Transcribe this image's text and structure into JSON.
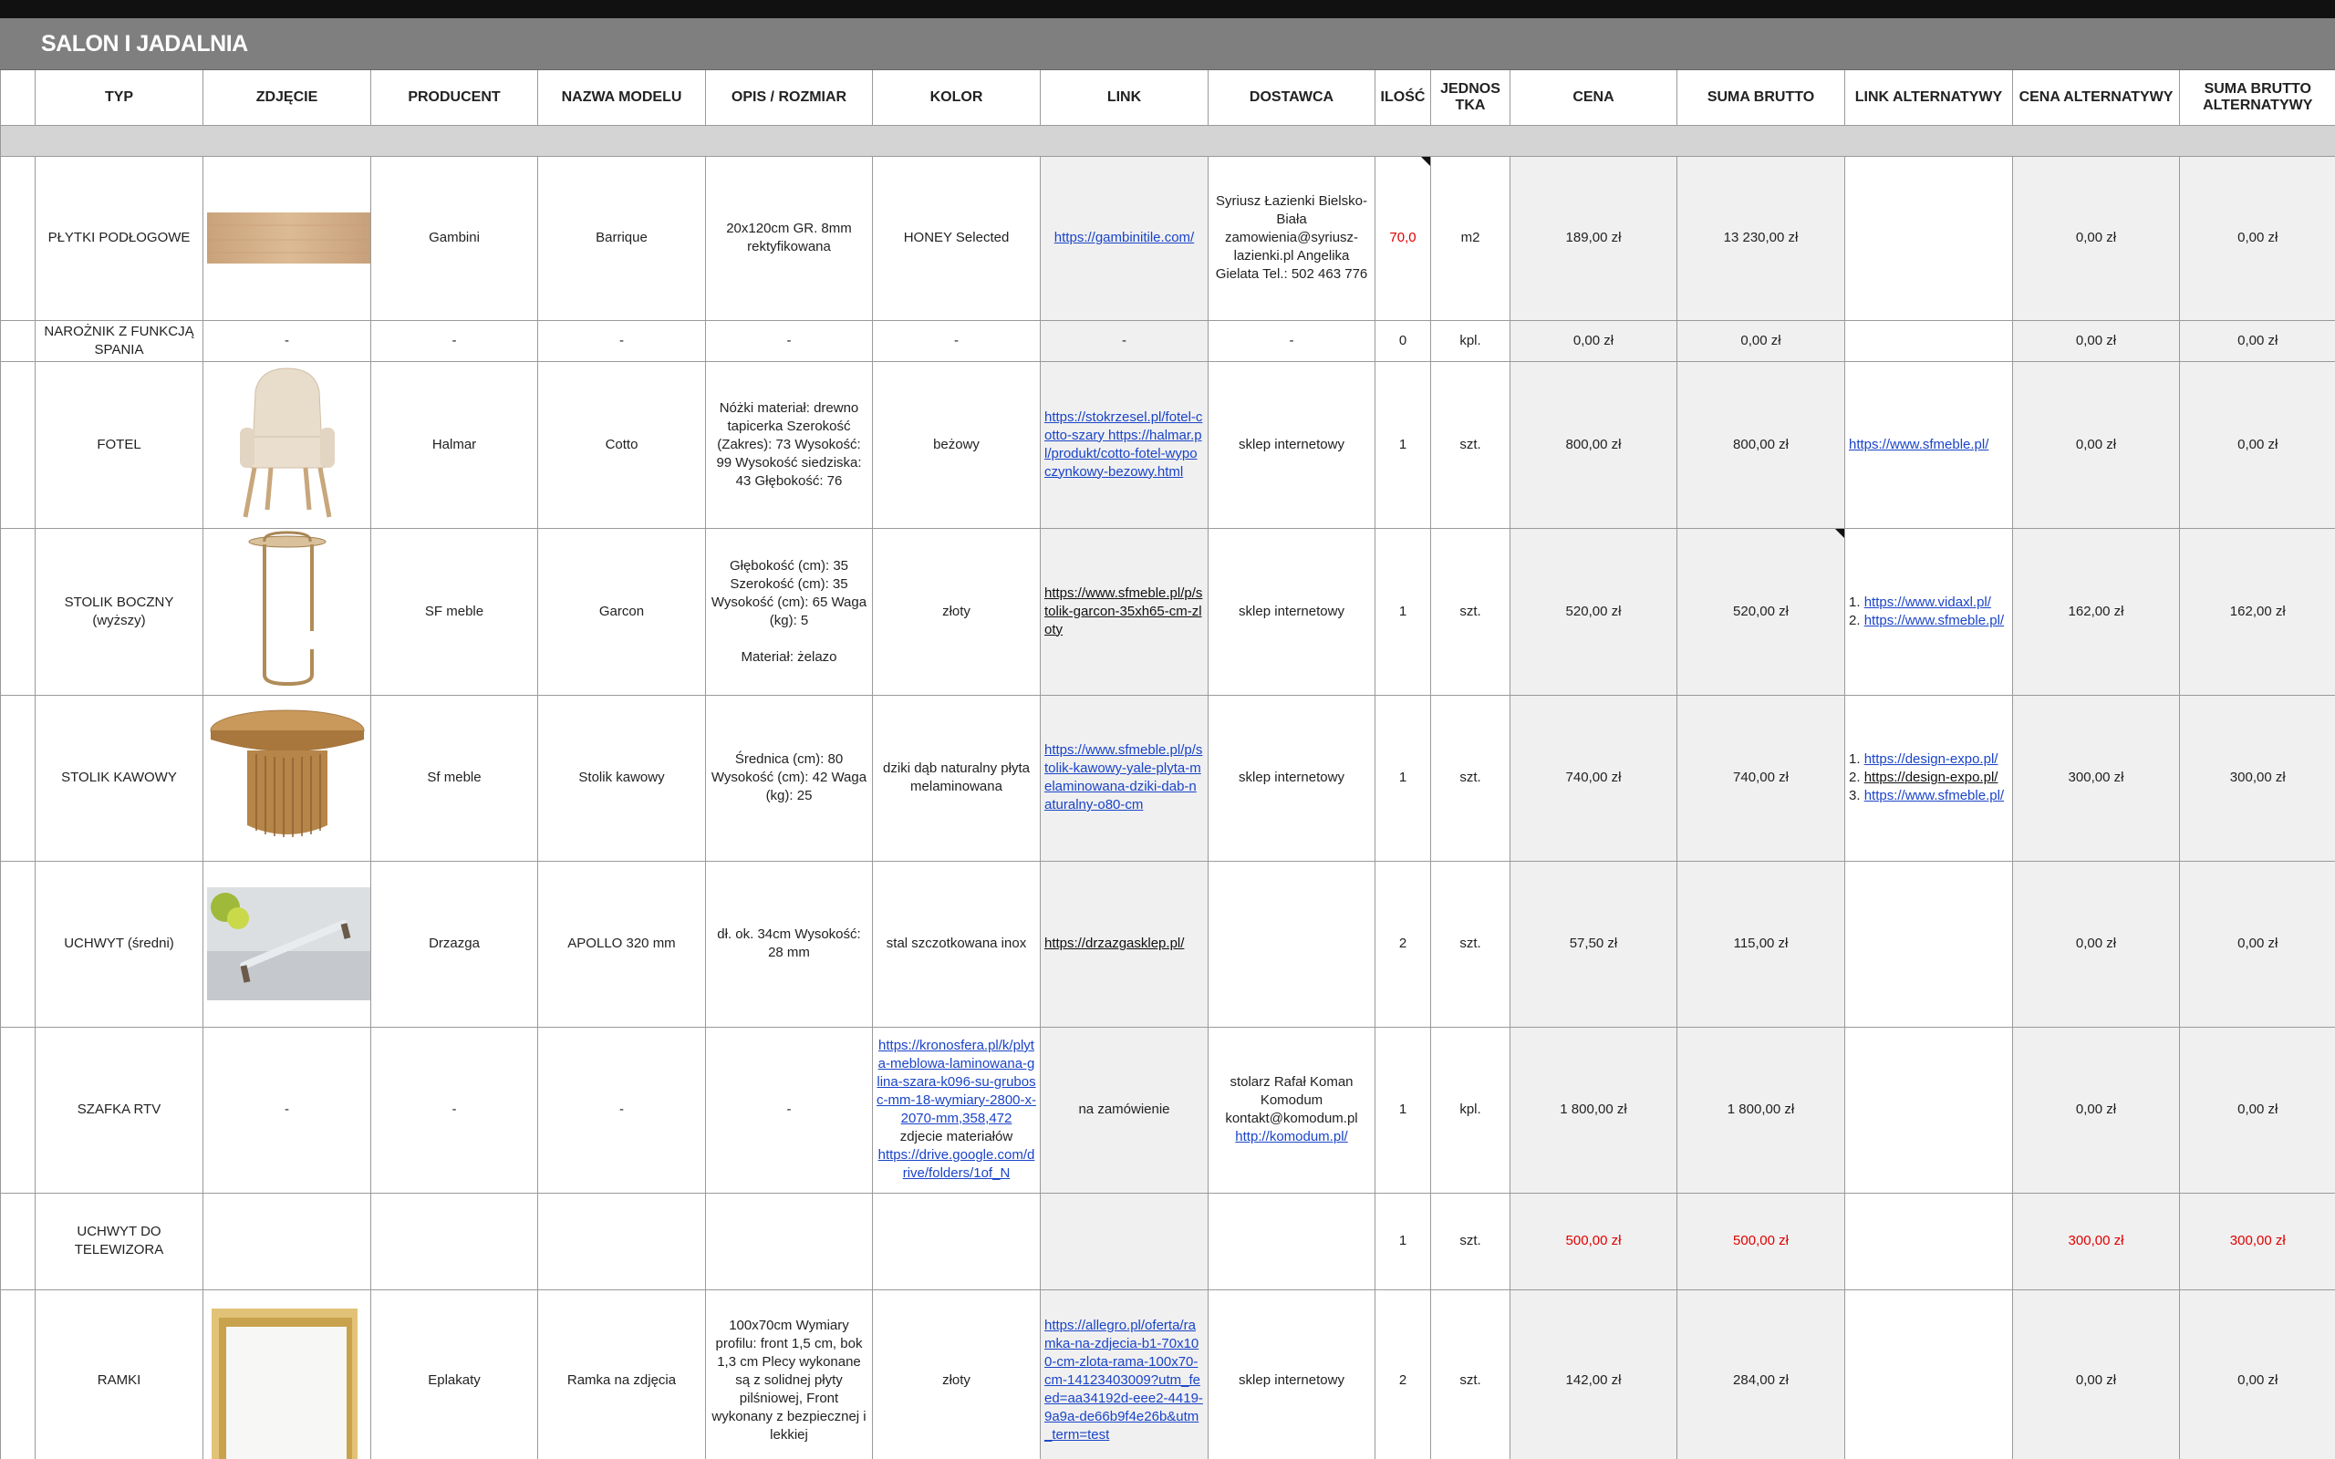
{
  "sheet_title": "SALON I JADALNIA",
  "headers": {
    "typ": "TYP",
    "zdjecie": "ZDJĘCIE",
    "producent": "PRODUCENT",
    "nazwa": "NAZWA MODELU",
    "opis": "OPIS / ROZMIAR",
    "kolor": "KOLOR",
    "link": "LINK",
    "dostawca": "DOSTAWCA",
    "ilosc": "ILOŚĆ",
    "jednostka": "JEDNOS TKA",
    "cena": "CENA",
    "suma": "SUMA BRUTTO",
    "link_alt": "LINK ALTERNATYWY",
    "cena_alt": "CENA ALTERNATYWY",
    "suma_alt": "SUMA BRUTTO ALTERNATYWY"
  },
  "rows": {
    "plytki": {
      "typ": "PŁYTKI PODŁOGOWE",
      "producent": "Gambini",
      "nazwa": "Barrique",
      "opis": "20x120cm GR. 8mm rektyfikowana",
      "kolor": "HONEY Selected",
      "link": "https://gambinitile.com/",
      "dostawca": "Syriusz Łazienki Bielsko-Biała zamowienia@syriusz-lazienki.pl Angelika Gielata Tel.: 502 463 776",
      "ilosc": "70,0",
      "jednostka": "m2",
      "cena": "189,00 zł",
      "suma": "13 230,00 zł",
      "link_alt": "",
      "cena_alt": "0,00 zł",
      "suma_alt": "0,00 zł"
    },
    "naroznik": {
      "typ": "NAROŻNIK Z FUNKCJĄ SPANIA",
      "zdjecie": "-",
      "producent": "-",
      "nazwa": "-",
      "opis": "-",
      "kolor": "-",
      "link": "-",
      "dostawca": "-",
      "ilosc": "0",
      "jednostka": "kpl.",
      "cena": "0,00 zł",
      "suma": "0,00 zł",
      "cena_alt": "0,00 zł",
      "suma_alt": "0,00 zł"
    },
    "fotel": {
      "typ": "FOTEL",
      "producent": "Halmar",
      "nazwa": "Cotto",
      "opis": "Nóżki materiał: drewno tapicerka Szerokość (Zakres): 73 Wysokość: 99 Wysokość siedziska: 43 Głębokość: 76",
      "kolor": "beżowy",
      "link": "https://stokrzesel.pl/fotel-cotto-szary https://halmar.pl/produkt/cotto-fotel-wypoczynkowy-bezowy.html",
      "dostawca": "sklep internetowy",
      "ilosc": "1",
      "jednostka": "szt.",
      "cena": "800,00 zł",
      "suma": "800,00 zł",
      "link_alt": "https://www.sfmeble.pl/",
      "cena_alt": "0,00 zł",
      "suma_alt": "0,00 zł"
    },
    "stolik_boczny": {
      "typ": "STOLIK BOCZNY (wyższy)",
      "producent": "SF meble",
      "nazwa": "Garcon",
      "opis": "Głębokość (cm): 35 Szerokość (cm): 35 Wysokość (cm): 65 Waga (kg): 5",
      "opis2": "Materiał: żelazo",
      "kolor": "złoty",
      "link": "https://www.sfmeble.pl/p/stolik-garcon-35xh65-cm-zloty",
      "dostawca": "sklep internetowy",
      "ilosc": "1",
      "jednostka": "szt.",
      "cena": "520,00 zł",
      "suma": "520,00 zł",
      "link_alt_1_num": "1.",
      "link_alt_1": "https://www.vidaxl.pl/",
      "link_alt_2_num": "2.",
      "link_alt_2": "https://www.sfmeble.pl/",
      "cena_alt": "162,00 zł",
      "suma_alt": "162,00 zł"
    },
    "stolik_kawowy": {
      "typ": "STOLIK KAWOWY",
      "producent": "Sf meble",
      "nazwa": "Stolik kawowy",
      "opis": "Średnica (cm): 80 Wysokość (cm): 42 Waga (kg): 25",
      "kolor": "dziki dąb naturalny płyta melaminowana",
      "link": "https://www.sfmeble.pl/p/stolik-kawowy-yale-plyta-melaminowana-dziki-dab-naturalny-o80-cm",
      "dostawca": "sklep internetowy",
      "ilosc": "1",
      "jednostka": "szt.",
      "cena": "740,00 zł",
      "suma": "740,00 zł",
      "link_alt_1_num": "1.",
      "link_alt_1": "https://design-expo.pl/",
      "link_alt_2_num": "2.",
      "link_alt_2": "https://design-expo.pl/",
      "link_alt_3_num": "3.",
      "link_alt_3": "https://www.sfmeble.pl/",
      "cena_alt": "300,00 zł",
      "suma_alt": "300,00 zł"
    },
    "uchwyt_sredni": {
      "typ": "UCHWYT (średni)",
      "producent": "Drzazga",
      "nazwa": "APOLLO 320 mm",
      "opis": "dł. ok. 34cm Wysokość: 28 mm",
      "kolor": "stal szczotkowana inox",
      "link": "https://drzazgasklep.pl/",
      "dostawca": "",
      "ilosc": "2",
      "jednostka": "szt.",
      "cena": "57,50 zł",
      "suma": "115,00 zł",
      "cena_alt": "0,00 zł",
      "suma_alt": "0,00 zł"
    },
    "szafka_rtv": {
      "typ": "SZAFKA RTV",
      "zdjecie": "-",
      "producent": "-",
      "nazwa": "-",
      "opis": "-",
      "kolor_link1": "https://kronosfera.pl/k/plyta-meblowa-laminowana-glina-szara-k096-su-grubosc-mm-18-wymiary-2800-x-2070-mm,358,472",
      "kolor_text": "zdjecie materiałów",
      "kolor_link2": "https://drive.google.com/drive/folders/1of_N",
      "link": "na zamówienie",
      "dostawca": "stolarz Rafał Koman Komodum kontakt@komodum.pl",
      "dostawca_link": "http://komodum.pl/",
      "ilosc": "1",
      "jednostka": "kpl.",
      "cena": "1 800,00 zł",
      "suma": "1 800,00 zł",
      "cena_alt": "0,00 zł",
      "suma_alt": "0,00 zł"
    },
    "uchwyt_tv": {
      "typ": "UCHWYT DO TELEWIZORA",
      "ilosc": "1",
      "jednostka": "szt.",
      "cena": "500,00 zł",
      "suma": "500,00 zł",
      "cena_alt": "300,00 zł",
      "suma_alt": "300,00 zł"
    },
    "ramki": {
      "typ": "RAMKI",
      "producent": "Eplakaty",
      "nazwa": "Ramka na zdjęcia",
      "opis": "100x70cm Wymiary profilu: front 1,5 cm, bok 1,3 cm Plecy wykonane są z solidnej płyty pilśniowej, Front wykonany z bezpiecznej i lekkiej",
      "kolor": "złoty",
      "link": "https://allegro.pl/oferta/ramka-na-zdjecia-b1-70x100-cm-zlota-rama-100x70-cm-14123403009?utm_feed=aa34192d-eee2-4419-9a9a-de66b9f4e26b&utm_term=test",
      "dostawca": "sklep internetowy",
      "ilosc": "2",
      "jednostka": "szt.",
      "cena": "142,00 zł",
      "suma": "284,00 zł",
      "cena_alt": "0,00 zł",
      "suma_alt": "0,00 zł"
    }
  },
  "colors": {
    "title_bg": "#7f7f7f",
    "link": "#1a44c8",
    "negative": "#e00000",
    "shaded_column": "#f0f0f0"
  }
}
